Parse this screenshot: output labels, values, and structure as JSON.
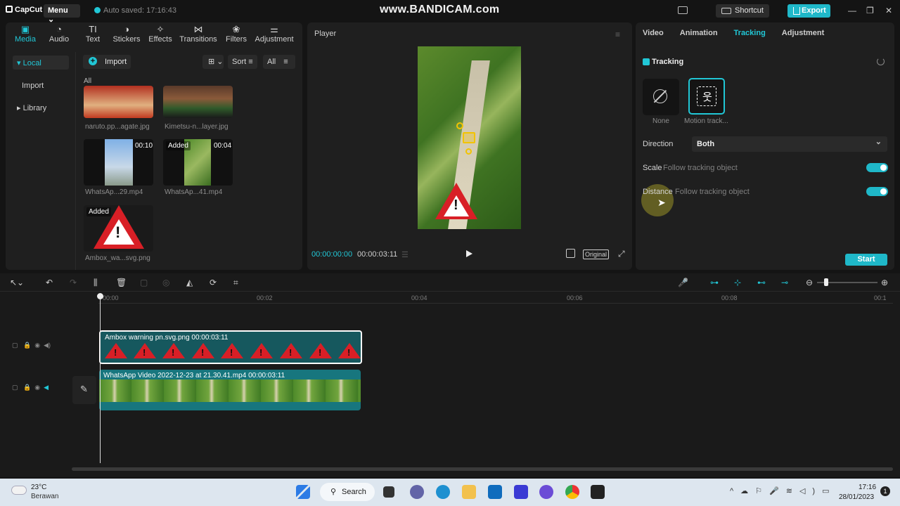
{
  "titlebar": {
    "app_name": "CapCut",
    "menu_label": "Menu",
    "autosave": "Auto saved: 17:16:43",
    "watermark": "www.BANDICAM.com",
    "shortcut_label": "Shortcut",
    "export_label": "Export"
  },
  "media": {
    "tools": [
      {
        "label": "Media",
        "icon": "media-icon"
      },
      {
        "label": "Audio",
        "icon": "audio-icon"
      },
      {
        "label": "Text",
        "icon": "text-icon"
      },
      {
        "label": "Stickers",
        "icon": "stickers-icon"
      },
      {
        "label": "Effects",
        "icon": "effects-icon"
      },
      {
        "label": "Transitions",
        "icon": "transitions-icon"
      },
      {
        "label": "Filters",
        "icon": "filters-icon"
      },
      {
        "label": "Adjustment",
        "icon": "adjustment-icon"
      }
    ],
    "sidebar": {
      "local": "Local",
      "import": "Import",
      "library": "Library"
    },
    "import_label": "Import",
    "sort_label": "Sort",
    "filter_label": "All",
    "section_label": "All",
    "items": [
      {
        "name": "naruto.pp...agate.jpg",
        "duration": "",
        "added": ""
      },
      {
        "name": "Kimetsu-n...layer.jpg",
        "duration": "",
        "added": ""
      },
      {
        "name": "WhatsAp...29.mp4",
        "duration": "00:10",
        "added": ""
      },
      {
        "name": "WhatsAp...41.mp4",
        "duration": "00:04",
        "added": "Added"
      },
      {
        "name": "Ambox_wa...svg.png",
        "duration": "",
        "added": "Added"
      }
    ]
  },
  "player": {
    "title": "Player",
    "current_time": "00:00:00:00",
    "total_time": "00:00:03:11",
    "ratio_label": "Original"
  },
  "props": {
    "tabs": [
      "Video",
      "Animation",
      "Tracking",
      "Adjustment"
    ],
    "active_tab": "Tracking",
    "section_title": "Tracking",
    "options": [
      {
        "label": "None"
      },
      {
        "label": "Motion track..."
      }
    ],
    "direction_label": "Direction",
    "direction_value": "Both",
    "scale_label": "Scale",
    "scale_sub": "Follow tracking object",
    "distance_label": "Distance",
    "distance_sub": "Follow tracking object",
    "start_label": "Start"
  },
  "timeline": {
    "ruler": [
      "00:00",
      "00:02",
      "00:04",
      "00:06",
      "00:08",
      "00:1"
    ],
    "clips": [
      {
        "label": "Ambox warning  pn.svg.png   00:00:03:11"
      },
      {
        "label": "WhatsApp Video 2022-12-23 at 21.30.41.mp4   00:00:03:11"
      }
    ]
  },
  "taskbar": {
    "temperature": "23°C",
    "weather": "Berawan",
    "search_label": "Search",
    "time": "17:16",
    "date": "28/01/2023"
  },
  "colors": {
    "accent": "#21c7d6",
    "warning_red": "#d81f26"
  }
}
